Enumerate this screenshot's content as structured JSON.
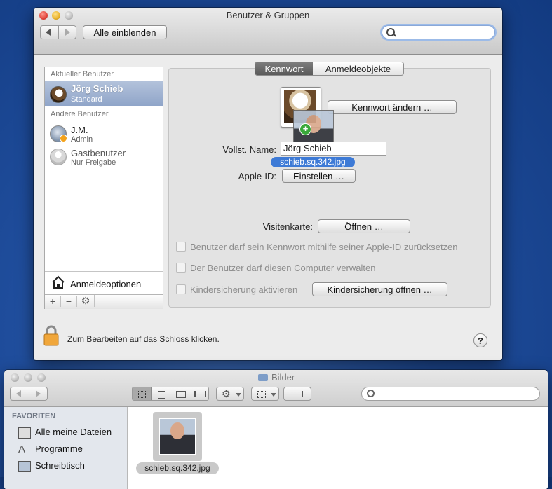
{
  "prefs_window": {
    "title": "Benutzer & Gruppen",
    "show_all_label": "Alle einblenden",
    "search": {
      "placeholder": "",
      "value": ""
    },
    "users": {
      "current_header": "Aktueller Benutzer",
      "current": {
        "name": "Jörg Schieb",
        "role": "Standard",
        "avatar": "eagle-icon"
      },
      "others_header": "Andere Benutzer",
      "others": [
        {
          "name": "J.M.",
          "role": "Admin",
          "avatar": "user-icon"
        },
        {
          "name": "Gastbenutzer",
          "role": "Nur Freigabe",
          "avatar": "guest-icon"
        }
      ],
      "login_options": "Anmeldeoptionen",
      "add_symbol": "+",
      "remove_symbol": "−",
      "gear_symbol": "⚙"
    },
    "tabs": {
      "password": "Kennwort",
      "login_items": "Anmeldeobjekte",
      "active": "Kennwort"
    },
    "change_password_label": "Kennwort ändern …",
    "full_name_label": "Vollst. Name:",
    "full_name_value": "Jörg Schieb",
    "drag_filename": "schieb.sq.342.jpg",
    "drag_plus": "+",
    "apple_id_label": "Apple-ID:",
    "apple_id_button": "Einstellen …",
    "card_label": "Visitenkarte:",
    "card_button": "Öffnen …",
    "checkboxes": [
      "Benutzer darf sein Kennwort mithilfe seiner Apple-ID zurücksetzen",
      "Der Benutzer darf diesen Computer verwalten",
      "Kindersicherung aktivieren"
    ],
    "parental_button": "Kindersicherung öffnen …",
    "lock_text": "Zum Bearbeiten auf das Schloss klicken.",
    "help_symbol": "?"
  },
  "finder_window": {
    "title": "Bilder",
    "sidebar_header": "FAVORITEN",
    "sidebar_items": [
      {
        "label": "Alle meine Dateien",
        "icon": "all-files-icon"
      },
      {
        "label": "Programme",
        "icon": "applications-icon"
      },
      {
        "label": "Schreibtisch",
        "icon": "desktop-icon"
      }
    ],
    "file": {
      "name": "schieb.sq.342.jpg"
    }
  },
  "colors": {
    "selection": "#8fa4c8",
    "filename_badge": "#3d7ad6",
    "desktop": "#1f4d9c"
  }
}
